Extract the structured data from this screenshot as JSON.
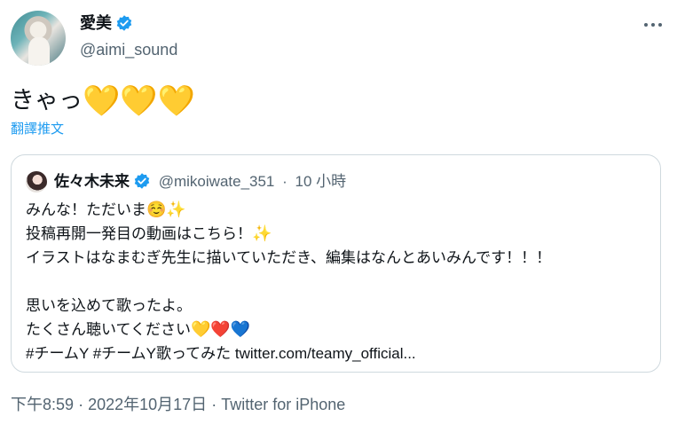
{
  "author": {
    "name": "愛美",
    "handle": "@aimi_sound"
  },
  "tweet": {
    "text": "きゃっ",
    "hearts": "💛💛💛",
    "translate_label": "翻譯推文"
  },
  "quote": {
    "name": "佐々木未来",
    "handle": "@mikoiwate_351",
    "separator": "·",
    "time": "10 小時",
    "lines": {
      "l1_text": "みんな！ただいま",
      "l1_emoji1": "☺️",
      "l1_emoji2": "✨",
      "l2_text": "投稿再開一発目の動画はこちら！",
      "l2_emoji": "✨",
      "l3_text": "イラストはなまむぎ先生に描いていただき、編集はなんとあいみんです！！！",
      "l5_text": "思いを込めて歌ったよ。",
      "l6_text": "たくさん聴いてください",
      "l6_heart_yellow": "💛",
      "l6_heart_red": "❤️",
      "l6_heart_blue": "💙",
      "hashtag1": "#チームY",
      "hashtag2": "#チームY歌ってみた",
      "link": "twitter.com/teamy_official..."
    }
  },
  "footer": {
    "time": "下午8:59",
    "sep1": "·",
    "date": "2022年10月17日",
    "sep2": "·",
    "source": "Twitter for iPhone"
  },
  "colors": {
    "accent": "#1d9bf0",
    "muted": "#536471",
    "border": "#cfd9de"
  },
  "icons": {
    "verified": "verified-badge-icon",
    "more": "more-options-icon"
  }
}
